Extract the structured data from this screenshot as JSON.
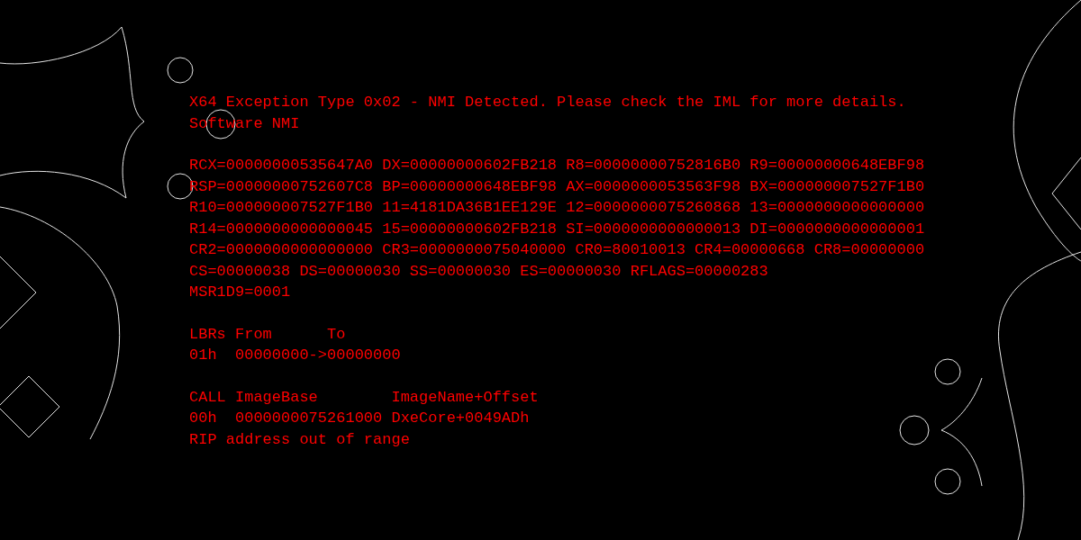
{
  "blocks": [
    {
      "lines": [
        "X64 Exception Type 0x02 - NMI Detected. Please check the IML for more details.",
        "Software NMI"
      ]
    },
    {
      "lines": [
        "RCX=00000000535647A0 DX=00000000602FB218 R8=00000000752816B0 R9=00000000648EBF98",
        "RSP=00000000752607C8 BP=00000000648EBF98 AX=0000000053563F98 BX=000000007527F1B0",
        "R10=000000007527F1B0 11=4181DA36B1EE129E 12=0000000075260868 13=0000000000000000",
        "R14=0000000000000045 15=00000000602FB218 SI=0000000000000013 DI=0000000000000001",
        "CR2=0000000000000000 CR3=0000000075040000 CR0=80010013 CR4=00000668 CR8=00000000",
        "CS=00000038 DS=00000030 SS=00000030 ES=00000030 RFLAGS=00000283",
        "MSR1D9=0001"
      ]
    },
    {
      "lines": [
        "LBRs From      To",
        "01h  00000000->00000000"
      ]
    },
    {
      "lines": [
        "CALL ImageBase        ImageName+Offset",
        "00h  0000000075261000 DxeCore+0049ADh",
        "RIP address out of range"
      ]
    }
  ]
}
